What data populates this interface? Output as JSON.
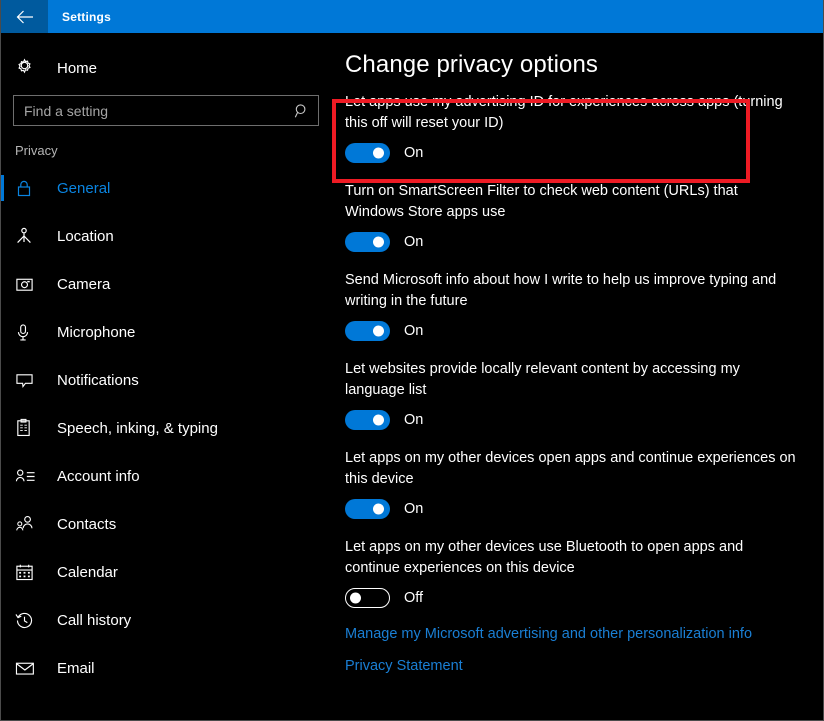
{
  "titlebar": {
    "back_icon": "back-arrow-icon",
    "title": "Settings"
  },
  "sidebar": {
    "home": {
      "label": "Home",
      "icon": "gear-icon"
    },
    "search": {
      "placeholder": "Find a setting",
      "value": "",
      "icon": "search-icon"
    },
    "section_label": "Privacy",
    "items": [
      {
        "label": "General",
        "icon": "lock-icon",
        "selected": true
      },
      {
        "label": "Location",
        "icon": "location-pin-icon",
        "selected": false
      },
      {
        "label": "Camera",
        "icon": "camera-icon",
        "selected": false
      },
      {
        "label": "Microphone",
        "icon": "microphone-icon",
        "selected": false
      },
      {
        "label": "Notifications",
        "icon": "speech-bubble-icon",
        "selected": false
      },
      {
        "label": "Speech, inking, & typing",
        "icon": "clipboard-icon",
        "selected": false
      },
      {
        "label": "Account info",
        "icon": "account-info-icon",
        "selected": false
      },
      {
        "label": "Contacts",
        "icon": "contacts-icon",
        "selected": false
      },
      {
        "label": "Calendar",
        "icon": "calendar-icon",
        "selected": false
      },
      {
        "label": "Call history",
        "icon": "call-history-icon",
        "selected": false
      },
      {
        "label": "Email",
        "icon": "envelope-icon",
        "selected": false
      }
    ]
  },
  "main": {
    "page_title": "Change privacy options",
    "settings": [
      {
        "description": "Let apps use my advertising ID for experiences across apps (turning this off will reset your ID)",
        "state": "On",
        "highlighted": true
      },
      {
        "description": "Turn on SmartScreen Filter to check web content (URLs) that Windows Store apps use",
        "state": "On",
        "highlighted": false
      },
      {
        "description": "Send Microsoft info about how I write to help us improve typing and writing in the future",
        "state": "On",
        "highlighted": false
      },
      {
        "description": "Let websites provide locally relevant content by accessing my language list",
        "state": "On",
        "highlighted": false
      },
      {
        "description": "Let apps on my other devices open apps and continue experiences on this device",
        "state": "On",
        "highlighted": false
      },
      {
        "description": "Let apps on my other devices use Bluetooth to open apps and continue experiences on this device",
        "state": "Off",
        "highlighted": false
      }
    ],
    "links": [
      {
        "label": "Manage my Microsoft advertising and other personalization info"
      },
      {
        "label": "Privacy Statement"
      }
    ]
  },
  "colors": {
    "accent_blue": "#0078d7",
    "titlebar_blue": "#0078d7",
    "back_button_blue": "#005a9e",
    "link_blue": "#1a7fd4",
    "highlight_red": "#ee1b24",
    "background": "#000000"
  }
}
